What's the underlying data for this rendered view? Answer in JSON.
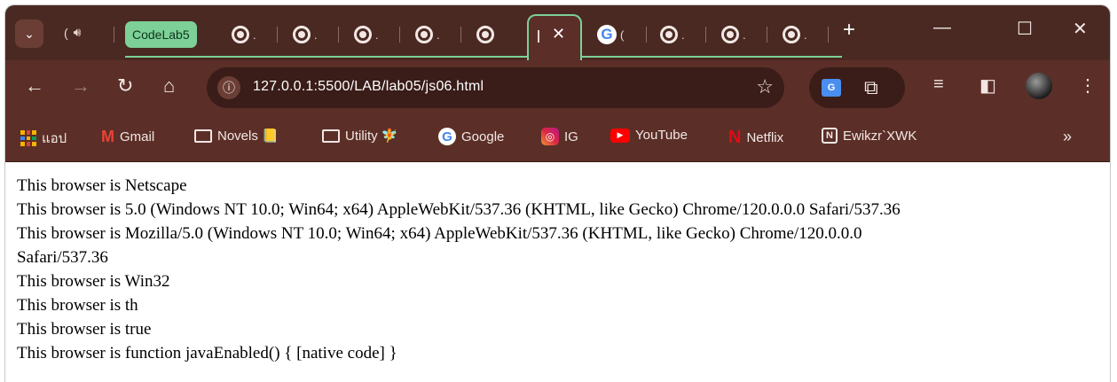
{
  "tabs": {
    "audio_tab_label": "(",
    "group_label": "CodeLab5",
    "dot": ".",
    "partial": "(",
    "new_tab": "+"
  },
  "window_controls": {
    "minimize": "—",
    "maximize": "☐",
    "close": "✕"
  },
  "toolbar": {
    "url": "127.0.0.1:5500/LAB/lab05/js06.html"
  },
  "bookmarks": {
    "items": [
      {
        "label": "แอป",
        "icon": "apps-icon"
      },
      {
        "label": "Gmail",
        "icon": "gmail-icon"
      },
      {
        "label": "Novels 📒",
        "icon": "folder-icon"
      },
      {
        "label": "Utility 🧚",
        "icon": "folder-icon"
      },
      {
        "label": "Google",
        "icon": "google-icon"
      },
      {
        "label": "IG",
        "icon": "instagram-icon"
      },
      {
        "label": "YouTube",
        "icon": "youtube-icon"
      },
      {
        "label": "Netflix",
        "icon": "netflix-icon"
      },
      {
        "label": "Ewikzr`XWK",
        "icon": "notion-icon"
      }
    ],
    "more": "»"
  },
  "content": {
    "lines": [
      "This browser is Netscape",
      "This browser is 5.0 (Windows NT 10.0; Win64; x64) AppleWebKit/537.36 (KHTML, like Gecko) Chrome/120.0.0.0 Safari/537.36",
      "This browser is Mozilla/5.0 (Windows NT 10.0; Win64; x64) AppleWebKit/537.36 (KHTML, like Gecko) Chrome/120.0.0.0",
      "Safari/537.36",
      "This browser is Win32",
      "This browser is th",
      "This browser is true",
      "This browser is function javaEnabled() { [native code] }"
    ]
  },
  "colors": {
    "tabstrip_bg": "#4a2922",
    "toolbar_bg": "#5b2f28",
    "group_green": "#7dd097",
    "page_bg": "#ffffff"
  }
}
